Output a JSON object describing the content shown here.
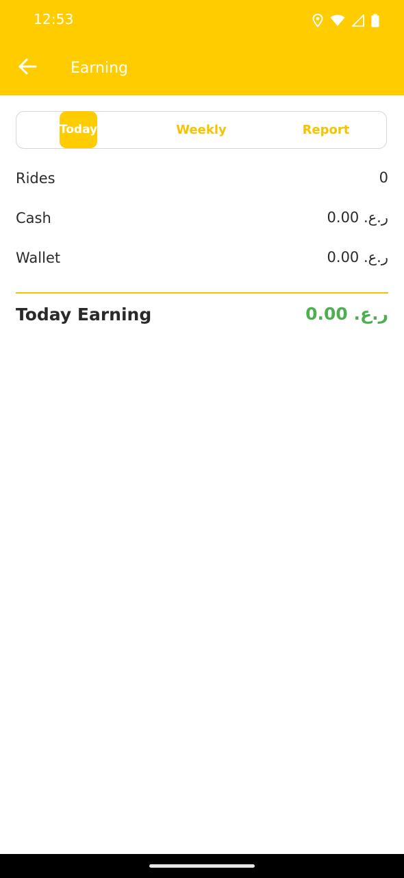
{
  "status_bar": {
    "time": "12:53",
    "icons": [
      "location-icon",
      "wifi-icon",
      "signal-icon",
      "battery-icon"
    ]
  },
  "app_bar": {
    "title": "Earning",
    "back_icon": "arrow-left-icon"
  },
  "tabs": [
    {
      "label": "Today",
      "active": true
    },
    {
      "label": "Weekly",
      "active": false
    },
    {
      "label": "Report",
      "active": false
    }
  ],
  "rows": {
    "rides": {
      "label": "Rides",
      "value": "0"
    },
    "cash": {
      "label": "Cash",
      "value": "0.00 .ر.ع"
    },
    "wallet": {
      "label": "Wallet",
      "value": "0.00 .ر.ع"
    }
  },
  "total": {
    "label": "Today Earning",
    "value": "0.00 .ر.ع"
  },
  "colors": {
    "brand": "#FFCC00",
    "tab_text": "#F5C400",
    "positive": "#4CAF50",
    "text": "#2a2a2a"
  }
}
